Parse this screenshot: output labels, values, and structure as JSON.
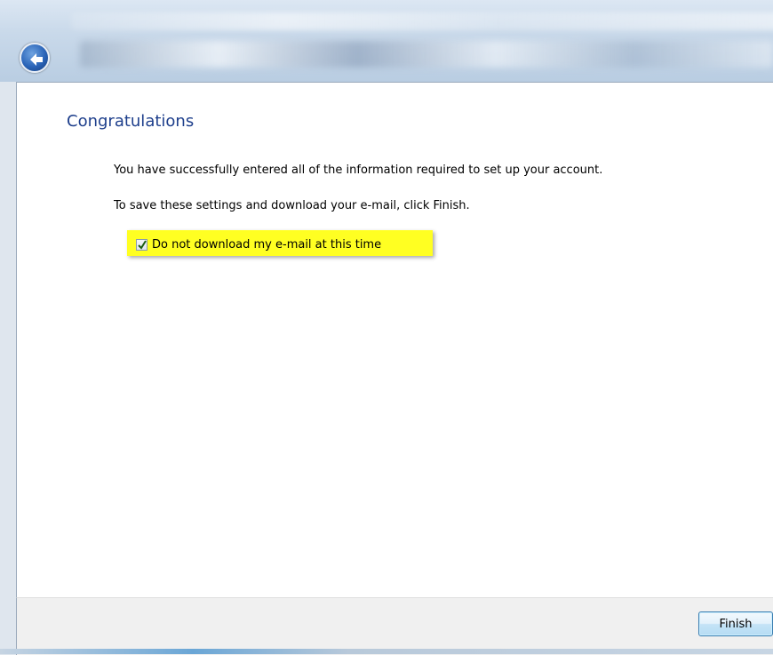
{
  "wizard": {
    "heading": "Congratulations",
    "message_line1": "You have successfully entered all of the information required to set up your account.",
    "message_line2": "To save these settings and download your e-mail, click Finish.",
    "checkbox": {
      "label": "Do not download my e-mail at this time",
      "checked": true
    },
    "finish_label": "Finish"
  },
  "icons": {
    "back": "back-arrow-icon",
    "check": "checkmark-icon"
  },
  "colors": {
    "heading": "#1e3f8c",
    "highlight": "#ffff22",
    "back_button": "#2a64b8"
  }
}
